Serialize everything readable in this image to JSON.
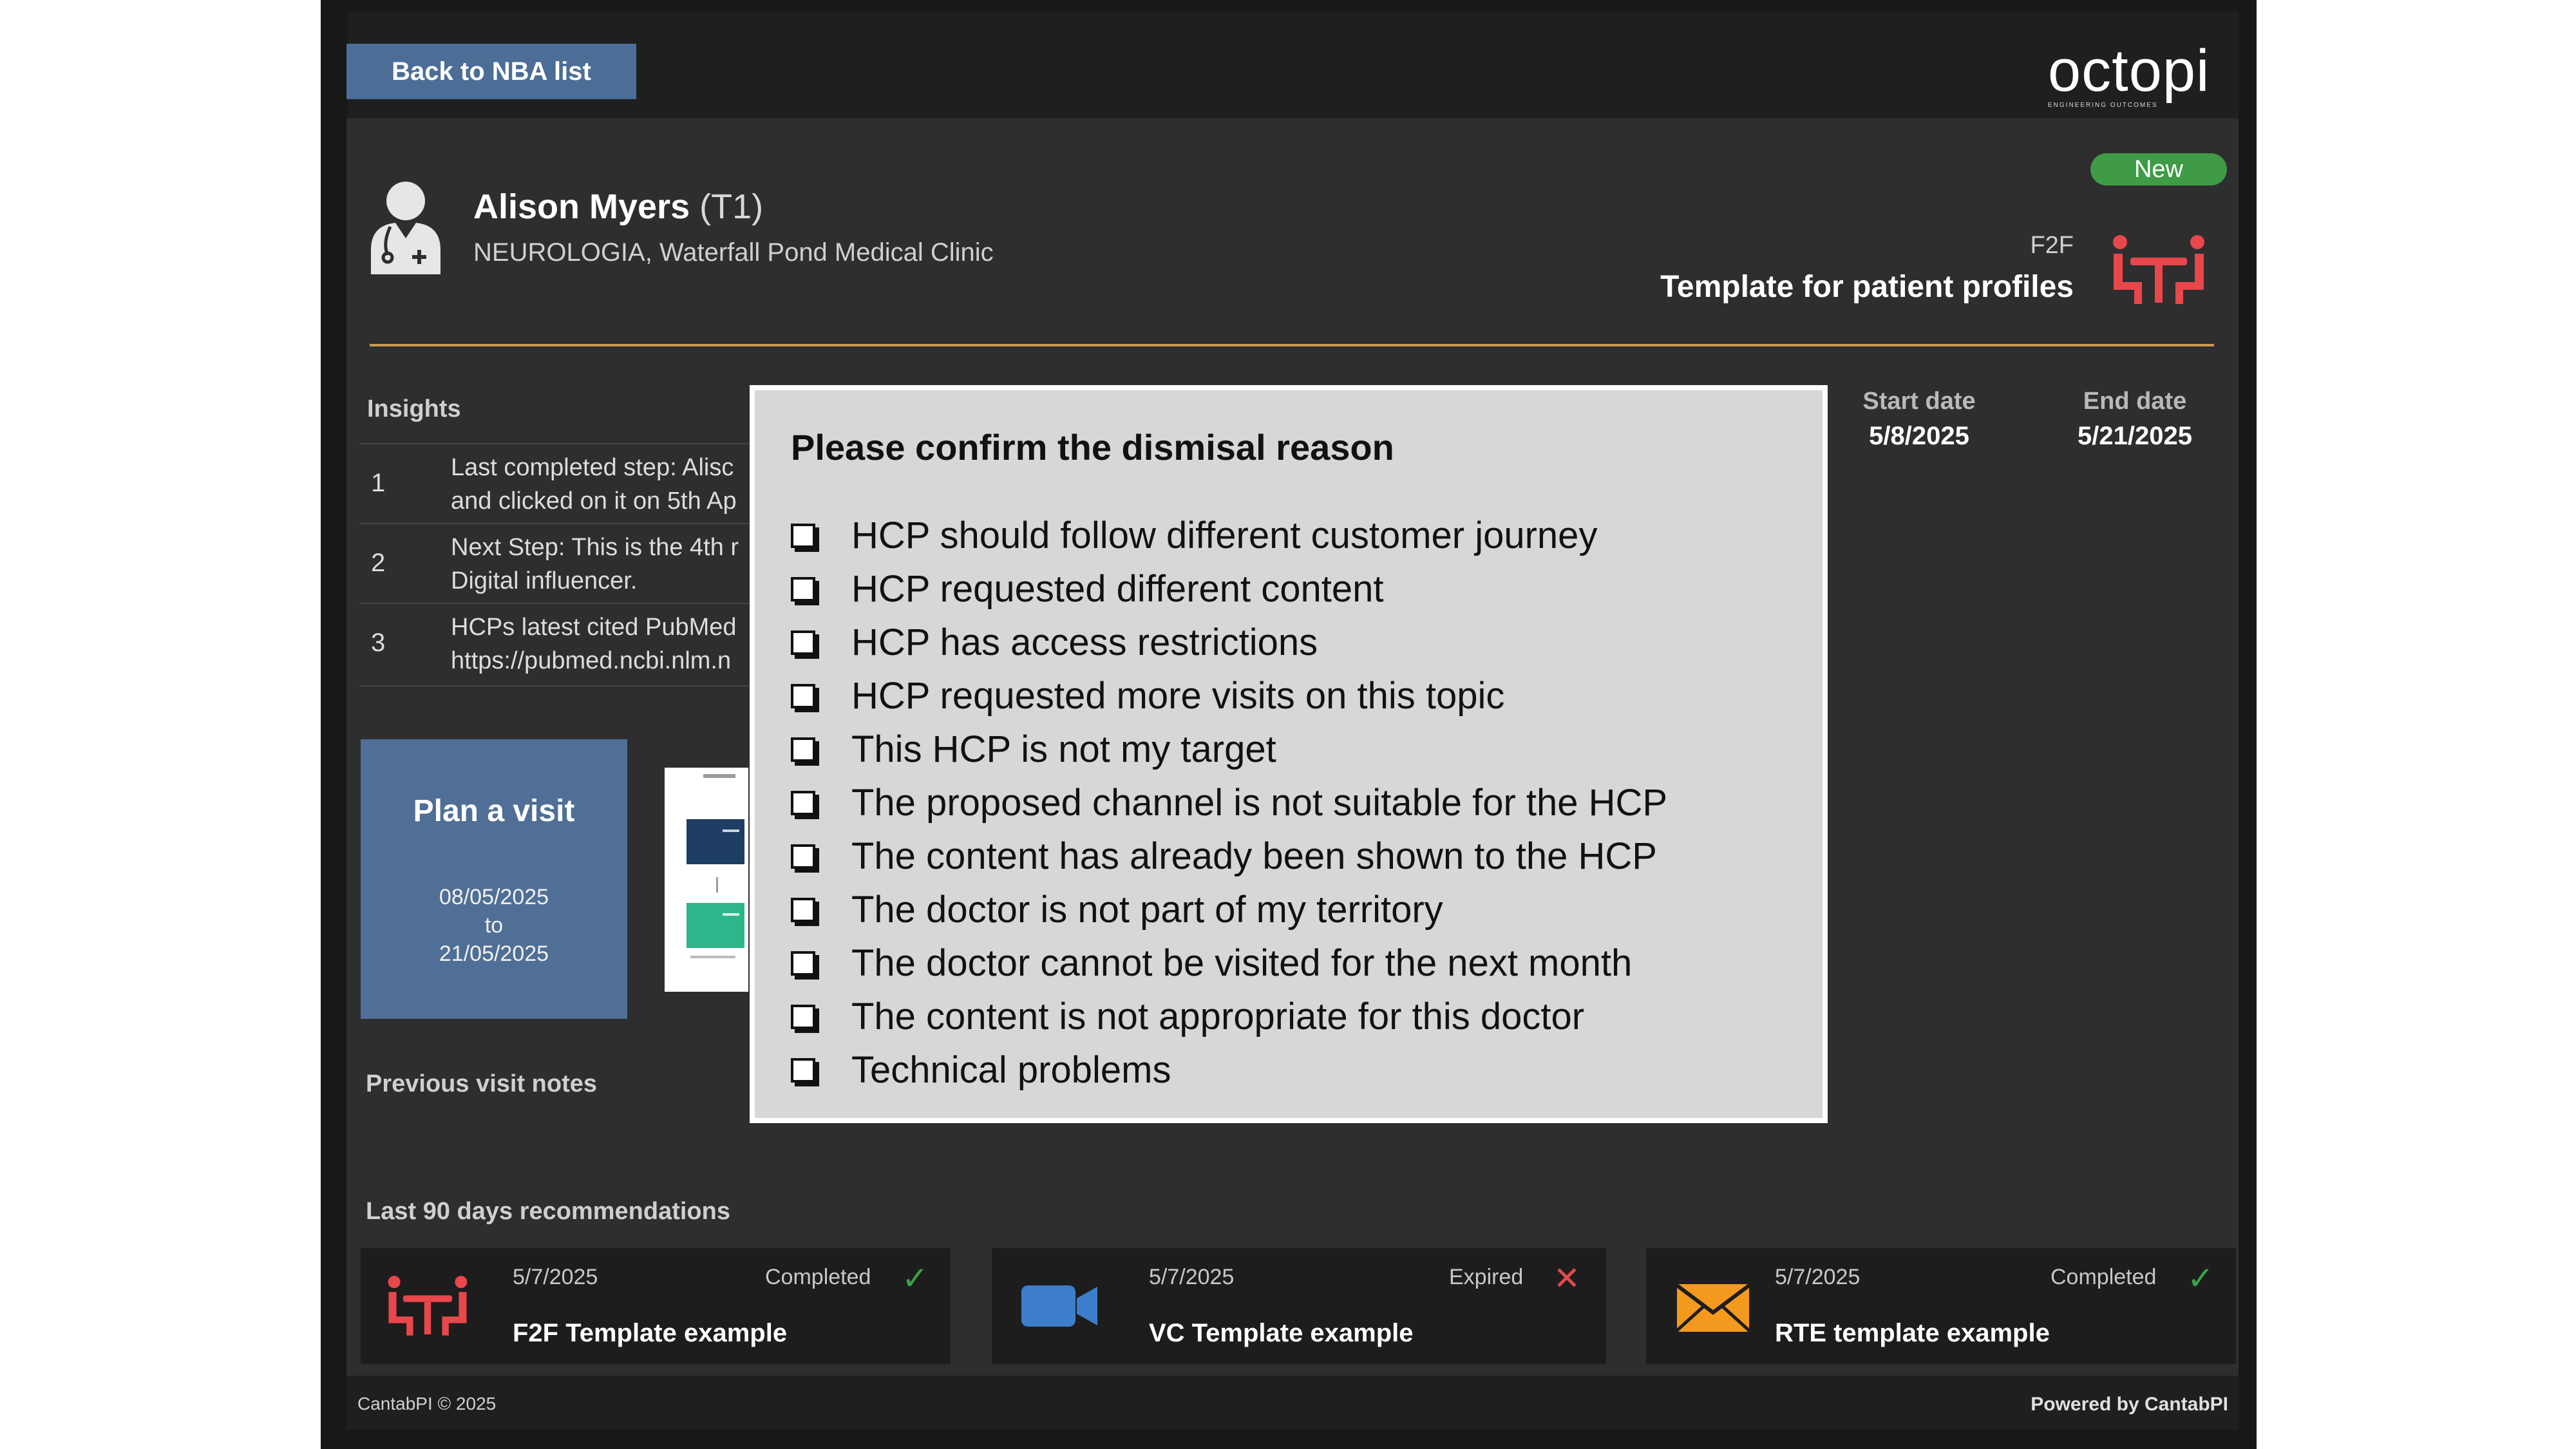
{
  "nav": {
    "back_label": "Back to NBA list"
  },
  "brand": {
    "logo_text": "octopi",
    "logo_tagline": "ENGINEERING OUTCOMES"
  },
  "doctor": {
    "name": "Alison Myers",
    "tier": "(T1)",
    "subtitle": "NEUROLOGIA, Waterfall Pond Medical Clinic"
  },
  "nba": {
    "status_badge": "New",
    "channel": "F2F",
    "template_title": "Template for patient profiles",
    "start_label": "Start date",
    "start_value": "5/8/2025",
    "end_label": "End date",
    "end_value": "5/21/2025"
  },
  "insights": {
    "title": "Insights",
    "rows": [
      {
        "num": "1",
        "line1": "Last completed step: Alisc",
        "line2": "and clicked on it on 5th Ap"
      },
      {
        "num": "2",
        "line1": "Next Step: This is the 4th r",
        "line2": "Digital influencer."
      },
      {
        "num": "3",
        "line1": "HCPs latest cited PubMed",
        "line2": "https://pubmed.ncbi.nlm.n"
      }
    ]
  },
  "plan": {
    "title": "Plan a visit",
    "from": "08/05/2025",
    "to_word": "to",
    "to": "21/05/2025"
  },
  "sections": {
    "previous_notes": "Previous visit notes",
    "last90": "Last 90 days recommendations"
  },
  "recommendations": [
    {
      "date": "5/7/2025",
      "status": "Completed",
      "title": "F2F Template example",
      "icon": "f2f-icon",
      "status_color": "#3aa34a"
    },
    {
      "date": "5/7/2025",
      "status": "Expired",
      "title": "VC Template example",
      "icon": "video-camera-icon",
      "status_color": "#e34a4a"
    },
    {
      "date": "5/7/2025",
      "status": "Completed",
      "title": "RTE template example",
      "icon": "envelope-icon",
      "status_color": "#3aa34a"
    }
  ],
  "modal": {
    "title": "Please confirm the dismisal reason",
    "reasons": [
      "HCP should follow different customer journey",
      "HCP requested different content",
      "HCP has access restrictions",
      "HCP requested more visits on this topic",
      "This HCP is not my target",
      "The proposed channel is not suitable for the HCP",
      "The content has already been shown to the HCP",
      "The doctor is not part of my territory",
      "The doctor cannot be visited for the next month",
      "The content is not appropriate for this doctor",
      "Technical problems"
    ]
  },
  "footer": {
    "left": "CantabPI © 2025",
    "right": "Powered by CantabPI"
  },
  "colors": {
    "accent_blue": "#4c6e96",
    "gold_divider": "#c89b52",
    "f2f_red": "#e8474b",
    "new_badge_green": "#3f9b45"
  }
}
